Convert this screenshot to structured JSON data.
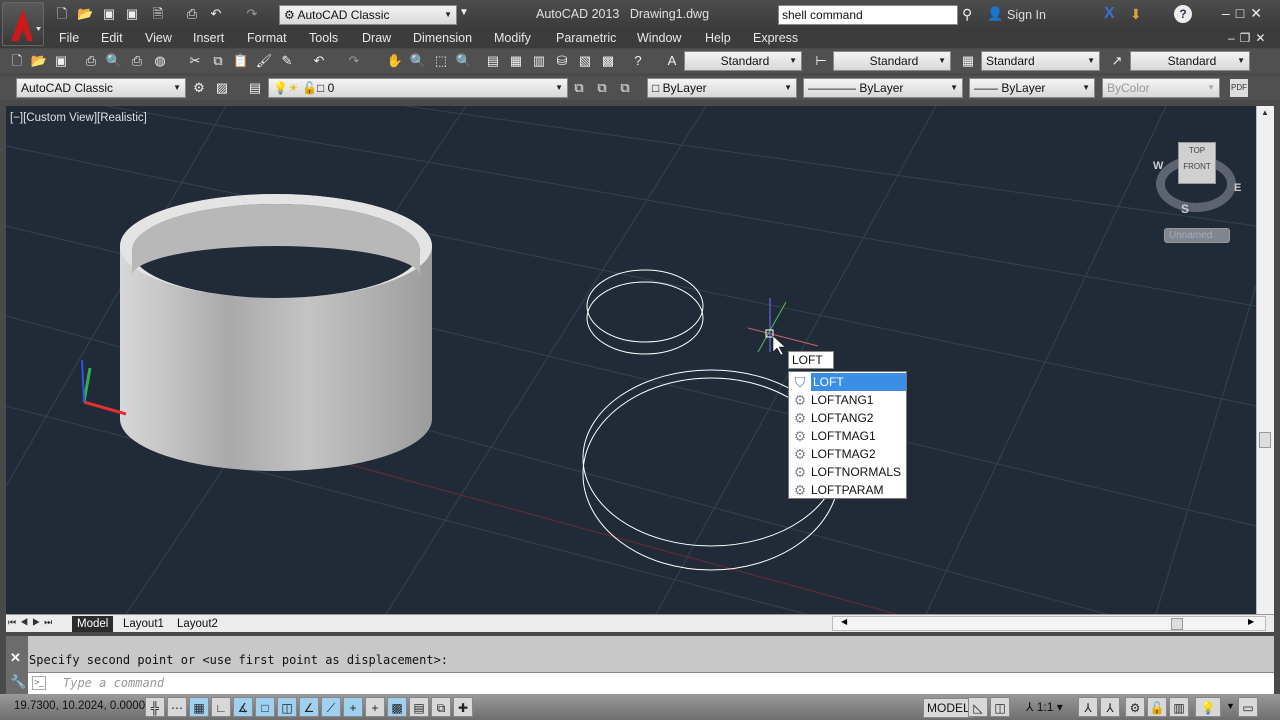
{
  "title_bar": {
    "app_title": "AutoCAD 2013",
    "document": "Drawing1.dwg",
    "workspace": "AutoCAD Classic",
    "search_value": "shell command",
    "sign_in": "Sign In"
  },
  "menu": [
    "File",
    "Edit",
    "View",
    "Insert",
    "Format",
    "Tools",
    "Draw",
    "Dimension",
    "Modify",
    "Parametric",
    "Window",
    "Help",
    "Express"
  ],
  "styles": {
    "text_style": "Standard",
    "dim_style": "Standard",
    "table_style": "Standard",
    "mleader_style": "Standard"
  },
  "workspaces_combo": "AutoCAD Classic",
  "layer_combo": "0",
  "properties": {
    "color": "ByLayer",
    "linetype": "ByLayer",
    "lineweight": "ByLayer",
    "plotstyle": "ByColor"
  },
  "viewport": {
    "label": "[−][Custom View][Realistic]",
    "viewcube": {
      "top": "TOP",
      "front": "FRONT",
      "w": "W",
      "e": "E",
      "s": "S",
      "ucs": "Unnamed"
    }
  },
  "autocomplete": {
    "typed": "LOFT",
    "items": [
      "LOFT",
      "LOFTANG1",
      "LOFTANG2",
      "LOFTMAG1",
      "LOFTMAG2",
      "LOFTNORMALS",
      "LOFTPARAM"
    ],
    "selected": 0
  },
  "tabs": [
    "Model",
    "Layout1",
    "Layout2"
  ],
  "command": {
    "history": "Specify second point or <use first point as displacement>:",
    "placeholder": "Type a command"
  },
  "status": {
    "coords": "19.7300, 10.2024, 0.0000",
    "model": "MODEL",
    "annotation_scale": "1:1"
  },
  "colors": {
    "viewport_bg": "#212b38",
    "highlight": "#3a8ee6"
  }
}
